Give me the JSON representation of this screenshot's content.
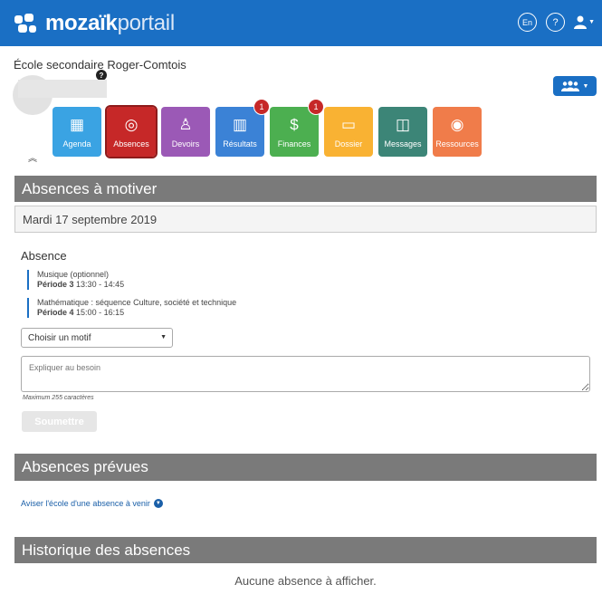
{
  "brand": {
    "name_bold": "mozaïk",
    "name_light": "portail"
  },
  "top_actions": {
    "language": "En",
    "help": "?"
  },
  "school": {
    "name": "École secondaire Roger-Comtois",
    "badge": "?"
  },
  "modules": [
    {
      "label": "Agenda",
      "icon": "calendar-icon",
      "glyph": "▦",
      "color": "#3aa3e3",
      "badge": ""
    },
    {
      "label": "Absences",
      "icon": "absences-icon",
      "glyph": "◎",
      "color": "#c62828",
      "badge": ""
    },
    {
      "label": "Devoirs",
      "icon": "homework-icon",
      "glyph": "♙",
      "color": "#9b59b6",
      "badge": ""
    },
    {
      "label": "Résultats",
      "icon": "results-bar-chart-icon",
      "glyph": "▥",
      "color": "#3b82d6",
      "badge": "1"
    },
    {
      "label": "Finances",
      "icon": "finances-dollar-icon",
      "glyph": "$",
      "color": "#4caf50",
      "badge": "1"
    },
    {
      "label": "Dossier",
      "icon": "folder-icon",
      "glyph": "▭",
      "color": "#f9b233",
      "badge": ""
    },
    {
      "label": "Messages",
      "icon": "messages-icon",
      "glyph": "◫",
      "color": "#3c8577",
      "badge": ""
    },
    {
      "label": "Ressources",
      "icon": "resources-icon",
      "glyph": "◉",
      "color": "#f07c4a",
      "badge": ""
    }
  ],
  "sections": {
    "motiver": "Absences à motiver",
    "prevues": "Absences prévues",
    "historique": "Historique des absences"
  },
  "absence": {
    "date": "Mardi 17 septembre 2019",
    "title": "Absence",
    "courses": [
      {
        "name": "Musique (optionnel)",
        "period": "Période 3",
        "time": "13:30 - 14:45"
      },
      {
        "name": "Mathématique : séquence Culture, société et technique",
        "period": "Période 4",
        "time": "15:00 - 16:15"
      }
    ],
    "reason_select": "Choisir un motif",
    "explain_placeholder": "Expliquer au besoin",
    "max_chars": "Maximum 255 caractères",
    "submit_label": "Soumettre"
  },
  "planned": {
    "link": "Aviser l'école d'une absence à venir"
  },
  "history": {
    "empty": "Aucune absence à afficher."
  }
}
